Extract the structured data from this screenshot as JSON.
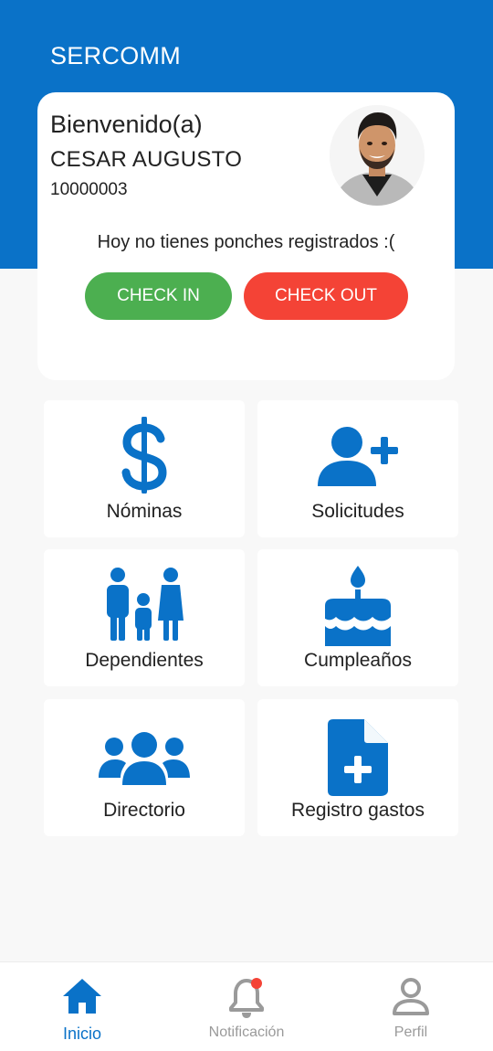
{
  "app": {
    "title": "SERCOMM"
  },
  "colors": {
    "primary": "#0a72c8",
    "check_in": "#4caf50",
    "check_out": "#f44336",
    "notification_dot": "#f44336",
    "inactive": "#9a9a9a"
  },
  "welcome": {
    "greeting": "Bienvenido(a)",
    "name": "CESAR AUGUSTO",
    "employee_id": "10000003",
    "status": "Hoy no tienes ponches registrados :(",
    "check_in_label": "CHECK IN",
    "check_out_label": "CHECK OUT",
    "avatar_icon": "user-photo"
  },
  "menu": [
    {
      "label": "Nóminas",
      "icon": "dollar-icon"
    },
    {
      "label": "Solicitudes",
      "icon": "user-plus-icon"
    },
    {
      "label": "Dependientes",
      "icon": "family-icon"
    },
    {
      "label": "Cumpleaños",
      "icon": "birthday-cake-icon"
    },
    {
      "label": "Directorio",
      "icon": "users-group-icon"
    },
    {
      "label": "Registro gastos",
      "icon": "file-plus-icon"
    }
  ],
  "bottom_nav": [
    {
      "label": "Inicio",
      "icon": "home-icon",
      "active": true
    },
    {
      "label": "Notificación",
      "icon": "bell-icon",
      "active": false,
      "has_badge": true
    },
    {
      "label": "Perfil",
      "icon": "profile-icon",
      "active": false
    }
  ]
}
